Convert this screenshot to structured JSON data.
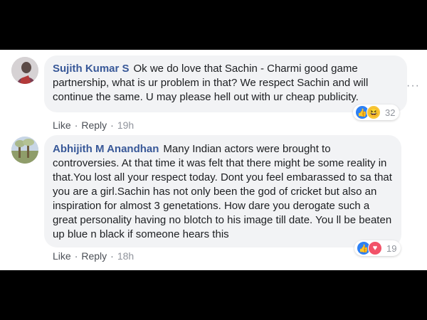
{
  "comments": [
    {
      "author": "Sujith Kumar S",
      "text": "Ok we do love that Sachin - Charmi good game partnership, what is ur problem in that? We respect Sachin and will continue the same. U may please hell out with ur cheap publicity.",
      "actions": {
        "like": "Like",
        "reply": "Reply",
        "separator": "·",
        "time": "19h"
      },
      "reactions": {
        "icons": [
          "like-icon",
          "haha-icon"
        ],
        "count": "32"
      },
      "more_icon": "···"
    },
    {
      "author": "Abhijith M Anandhan",
      "text": "Many Indian actors were brought to controversies. At that time it was felt that there might be some reality in that.You lost all your respect today. Dont you feel embarassed to sa that you are a girl.Sachin has not only been the god of cricket but also an inspiration for almost 3 genetations. How dare you derogate such a great personality having no blotch to his image till date. You ll be beaten up blue n black if someone hears this",
      "actions": {
        "like": "Like",
        "reply": "Reply",
        "separator": "·",
        "time": "18h"
      },
      "reactions": {
        "icons": [
          "like-icon",
          "love-icon"
        ],
        "count": "19"
      }
    }
  ],
  "colors": {
    "author_link": "#385898",
    "bubble_bg": "#f2f3f5",
    "like_reaction": "#2e81f4",
    "love_reaction": "#f25268",
    "haha_reaction": "#f7c638"
  }
}
